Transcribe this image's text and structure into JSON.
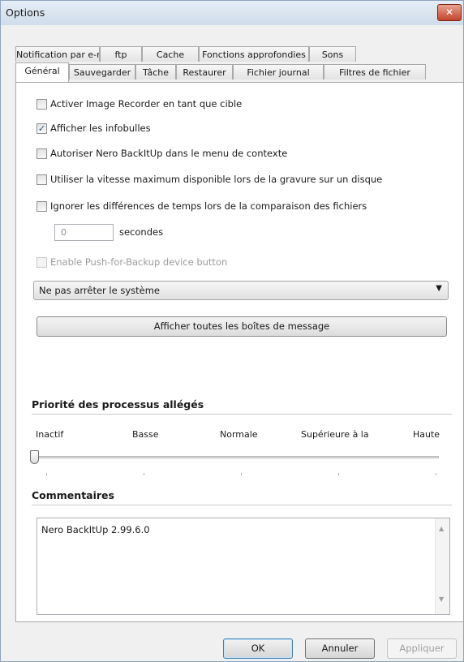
{
  "window": {
    "title": "Options",
    "close_glyph": "✕"
  },
  "tabs_row1": [
    "Notification par e-mail",
    "ftp",
    "Cache",
    "Fonctions approfondies",
    "Sons"
  ],
  "tabs_row2": [
    "Général",
    "Sauvegarder",
    "Tâche",
    "Restaurer",
    "Fichier journal",
    "Filtres de fichier"
  ],
  "active_tab": "Général",
  "general": {
    "checkboxes": [
      {
        "label": "Activer Image Recorder en tant que cible",
        "checked": false,
        "enabled": true
      },
      {
        "label": "Afficher les infobulles",
        "checked": true,
        "enabled": true
      },
      {
        "label": "Autoriser Nero BackItUp dans le menu de contexte",
        "checked": false,
        "enabled": true
      },
      {
        "label": "Utiliser la vitesse maximum disponible lors de la gravure sur un disque",
        "checked": false,
        "enabled": true
      },
      {
        "label": "Ignorer les différences de temps lors de la comparaison des fichiers",
        "checked": false,
        "enabled": true
      },
      {
        "label": "Enable Push-for-Backup device button",
        "checked": false,
        "enabled": false
      }
    ],
    "seconds_value": "0",
    "seconds_label": "secondes",
    "shutdown_dropdown_value": "Ne pas arrêter le système",
    "show_messages_button": "Afficher toutes les boîtes de message"
  },
  "priority": {
    "title": "Priorité des processus allégés",
    "levels": [
      "Inactif",
      "Basse",
      "Normale",
      "Supérieure à la",
      "Haute"
    ],
    "selected_index": 0
  },
  "comments": {
    "title": "Commentaires",
    "text": "Nero BackItUp 2.99.6.0"
  },
  "buttons": {
    "ok": "OK",
    "cancel": "Annuler",
    "apply": "Appliquer"
  },
  "icons": {
    "checkmark": "check-icon",
    "dropdown": "chevron-down-icon",
    "scroll_up": "scroll-up-icon",
    "scroll_down": "scroll-down-icon"
  }
}
